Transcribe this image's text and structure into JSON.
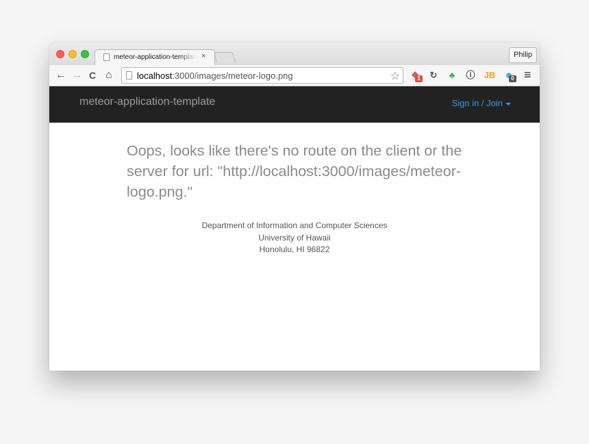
{
  "browser": {
    "tab_title": "meteor-application-template",
    "tab_close": "×",
    "profile_name": "Philip",
    "url_host": "localhost",
    "url_rest": ":3000/images/meteor-logo.png",
    "nav_icons": {
      "back": "←",
      "forward": "→",
      "reload": "C",
      "home": "⌂"
    },
    "star_icon": "☆",
    "extensions": [
      {
        "name": "colorful-puzzle-extension-icon",
        "glyph": "❖",
        "badge": "1",
        "color": "#d9534f"
      },
      {
        "name": "sync-extension-icon",
        "glyph": "↻",
        "color": "#555555"
      },
      {
        "name": "evernote-extension-icon",
        "glyph": "♣",
        "color": "#2db34a"
      },
      {
        "name": "onepassword-extension-icon",
        "glyph": "ⓘ",
        "color": "#444444"
      },
      {
        "name": "jetbrains-extension-icon",
        "glyph": "JB",
        "color": "#f3a31b"
      },
      {
        "name": "ghostery-extension-icon",
        "glyph": "☻",
        "badge": "0",
        "color": "#38a7e6"
      }
    ],
    "menu_icon": "≡"
  },
  "navbar": {
    "brand": "meteor-application-template",
    "signin": "Sign in / Join"
  },
  "main": {
    "message": "Oops, looks like there's no route on the client or the server for url: \"http://localhost:3000/images/meteor-logo.png.\""
  },
  "footer": {
    "line1": "Department of Information and Computer Sciences",
    "line2": "University of Hawaii",
    "line3": "Honolulu, HI 96822"
  },
  "colors": {
    "navbar_bg": "#222222",
    "brand": "#9d9d9d",
    "link": "#3a9ad9",
    "message": "#8a8a8a"
  }
}
